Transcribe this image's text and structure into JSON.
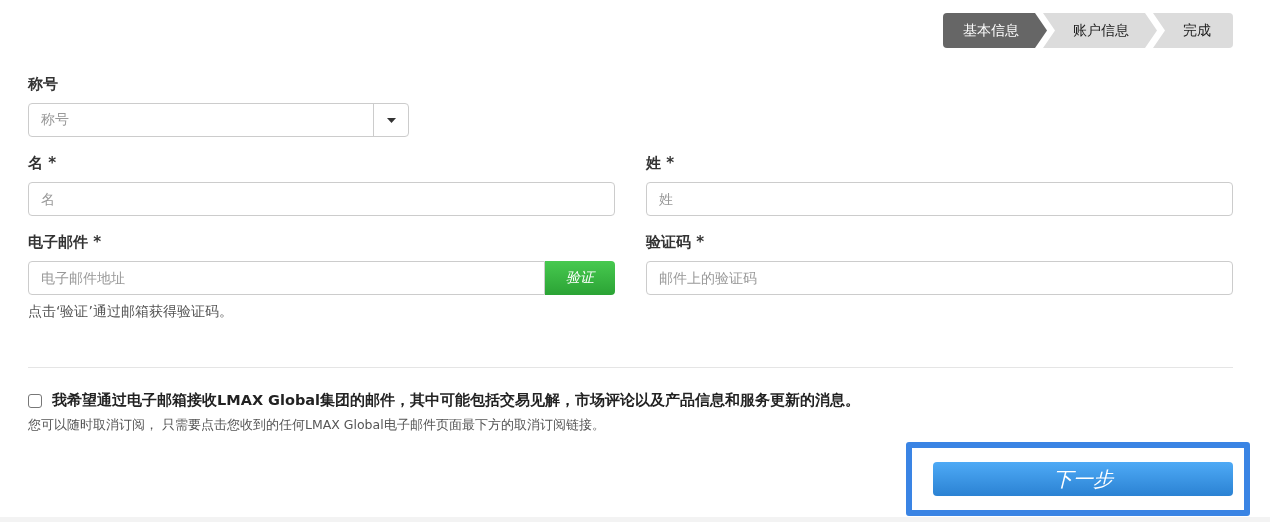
{
  "steps": [
    {
      "label": "基本信息",
      "selected": true
    },
    {
      "label": "账户信息",
      "selected": false
    },
    {
      "label": "完成",
      "selected": false
    }
  ],
  "title_field": {
    "label": "称号",
    "placeholder": "称号"
  },
  "first_name": {
    "label": "名 *",
    "placeholder": "名"
  },
  "last_name": {
    "label": "姓 *",
    "placeholder": "姓"
  },
  "email": {
    "label": "电子邮件 *",
    "placeholder": "电子邮件地址",
    "verify_button": "验证",
    "hint": "点击‘验证’通过邮箱获得验证码。"
  },
  "code": {
    "label": "验证码 *",
    "placeholder": "邮件上的验证码"
  },
  "consent": {
    "checked": false,
    "label": "我希望通过电子邮箱接收LMAX Global集团的邮件，其中可能包括交易见解，市场评论以及产品信息和服务更新的消息。",
    "note": "您可以随时取消订阅， 只需要点击您收到的任何LMAX Global电子邮件页面最下方的取消订阅链接。"
  },
  "next_button": {
    "label": "下一步",
    "highlighted": true
  }
}
